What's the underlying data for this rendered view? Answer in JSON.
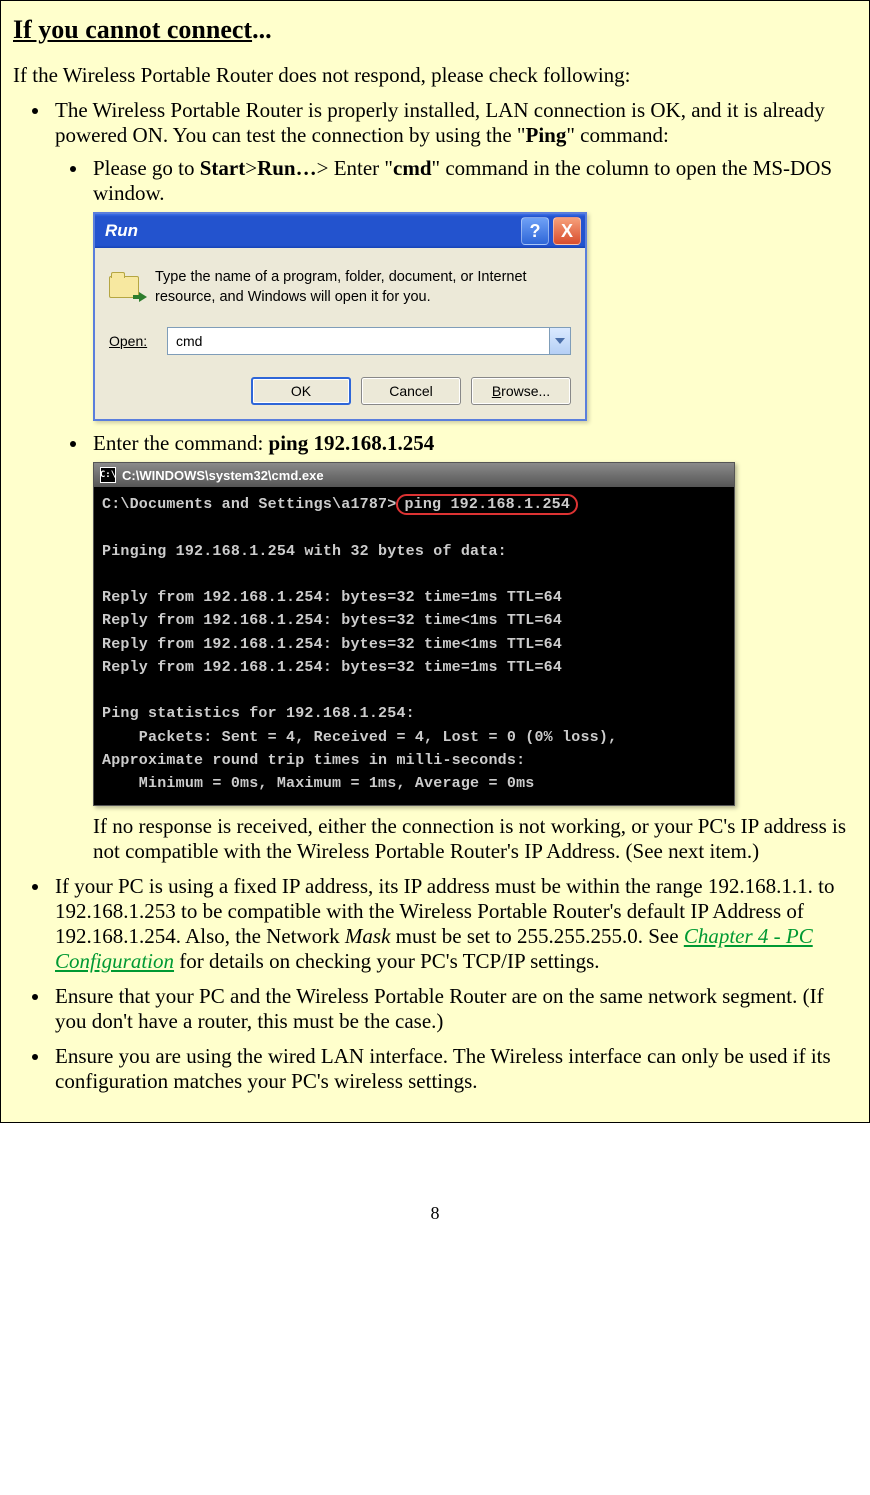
{
  "heading": {
    "underlined": "If you cannot connect",
    "rest": "..."
  },
  "intro": "If the Wireless Portable Router does not respond, please check following:",
  "bullets": {
    "b1_pre": "The Wireless Portable Router is properly installed, LAN connection is OK, and it is already powered ON. You can test the connection by using the \"",
    "b1_bold": "Ping",
    "b1_post": "\" command:",
    "b1a_1": "Please go to ",
    "b1a_start": "Start",
    "b1a_gt1": ">",
    "b1a_run": "Run…",
    "b1a_gt2": "> Enter \"",
    "b1a_cmd": "cmd",
    "b1a_3": "\" command in the column to open the MS-DOS window.",
    "b1b_1": "Enter the command:  ",
    "b1b_bold": "ping 192.168.1.254",
    "b1b_after": "If no response is received, either the connection is not working, or your PC's IP address is not compatible with the Wireless Portable Router's IP Address. (See next item.)",
    "b2_1": "If your PC is using a fixed IP address, its IP address must be within the range 192.168.1.1. to 192.168.1.253 to be compatible with the Wireless Portable Router's default IP Address of 192.168.1.254. Also, the Network ",
    "b2_mask": "Mask",
    "b2_2": " must be set to 255.255.255.0. See ",
    "b2_link": "Chapter 4 - PC Configuration",
    "b2_3": " for details on checking your PC's TCP/IP settings.",
    "b3": "Ensure that your PC and the Wireless Portable Router are on the same network segment. (If you don't have a router, this must be the case.)",
    "b4": "Ensure you are using the wired LAN interface. The Wireless interface can only be used if its configuration matches your PC's wireless settings."
  },
  "run_dialog": {
    "title": "Run",
    "help": "?",
    "close": "X",
    "desc": "Type the name of a program, folder, document, or Internet resource, and Windows will open it for you.",
    "label": "Open:",
    "value": "cmd",
    "ok": "OK",
    "cancel": "Cancel",
    "browse": "Browse..."
  },
  "cmd_window": {
    "title": "C:\\WINDOWS\\system32\\cmd.exe",
    "icon_text": "C:\\",
    "prompt_pre": "C:\\Documents and Settings\\a1787>",
    "prompt_cmd": "ping 192.168.1.254",
    "line_blank": "",
    "line_pinging": "Pinging 192.168.1.254 with 32 bytes of data:",
    "reply1": "Reply from 192.168.1.254: bytes=32 time=1ms TTL=64",
    "reply2": "Reply from 192.168.1.254: bytes=32 time<1ms TTL=64",
    "reply3": "Reply from 192.168.1.254: bytes=32 time<1ms TTL=64",
    "reply4": "Reply from 192.168.1.254: bytes=32 time=1ms TTL=64",
    "stats1": "Ping statistics for 192.168.1.254:",
    "stats2": "    Packets: Sent = 4, Received = 4, Lost = 0 (0% loss),",
    "stats3": "Approximate round trip times in milli-seconds:",
    "stats4": "    Minimum = 0ms, Maximum = 1ms, Average = 0ms"
  },
  "pagenum": "8"
}
